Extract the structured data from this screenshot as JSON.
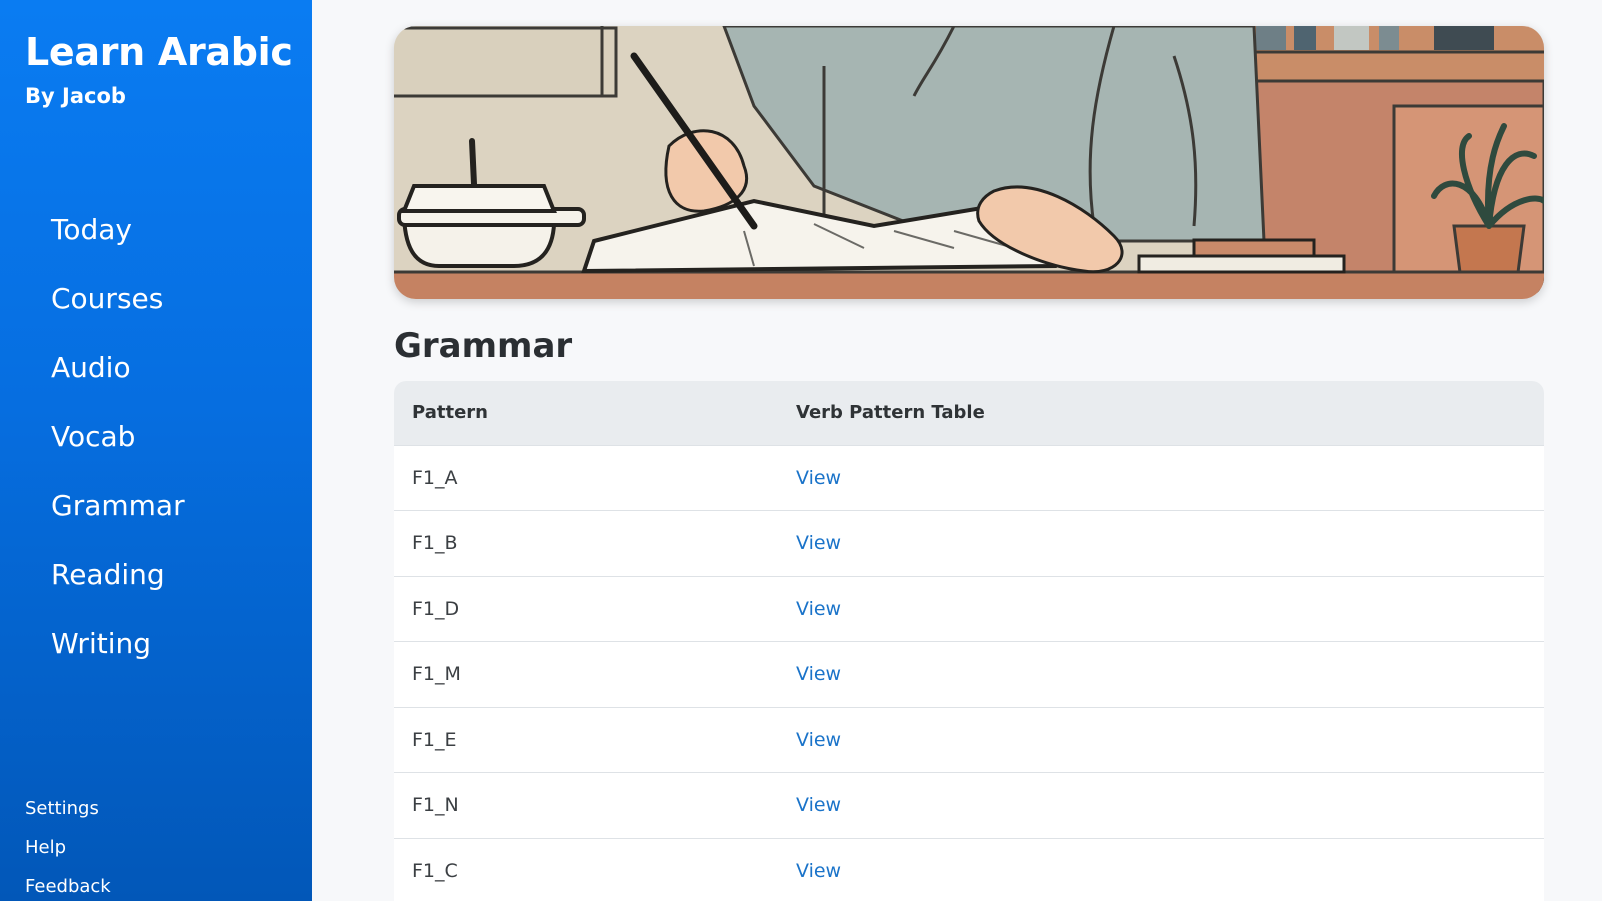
{
  "brand": {
    "title": "Learn Arabic",
    "subtitle": "By Jacob"
  },
  "nav": {
    "items": [
      {
        "label": "Today"
      },
      {
        "label": "Courses"
      },
      {
        "label": "Audio"
      },
      {
        "label": "Vocab"
      },
      {
        "label": "Grammar"
      },
      {
        "label": "Reading"
      },
      {
        "label": "Writing"
      }
    ]
  },
  "footer": {
    "settings": "Settings",
    "help": "Help",
    "feedback": "Feedback"
  },
  "main": {
    "section_title": "Grammar",
    "table": {
      "headers": [
        "Pattern",
        "Verb Pattern Table"
      ],
      "rows": [
        {
          "pattern": "F1_A",
          "link": "View"
        },
        {
          "pattern": "F1_B",
          "link": "View"
        },
        {
          "pattern": "F1_D",
          "link": "View"
        },
        {
          "pattern": "F1_M",
          "link": "View"
        },
        {
          "pattern": "F1_E",
          "link": "View"
        },
        {
          "pattern": "F1_N",
          "link": "View"
        },
        {
          "pattern": "F1_C",
          "link": "View"
        }
      ]
    }
  },
  "colors": {
    "sidebar_top": "#0a7cf2",
    "sidebar_bottom": "#0257b8",
    "link": "#1a73c9",
    "table_header_bg": "#e9ecef"
  }
}
